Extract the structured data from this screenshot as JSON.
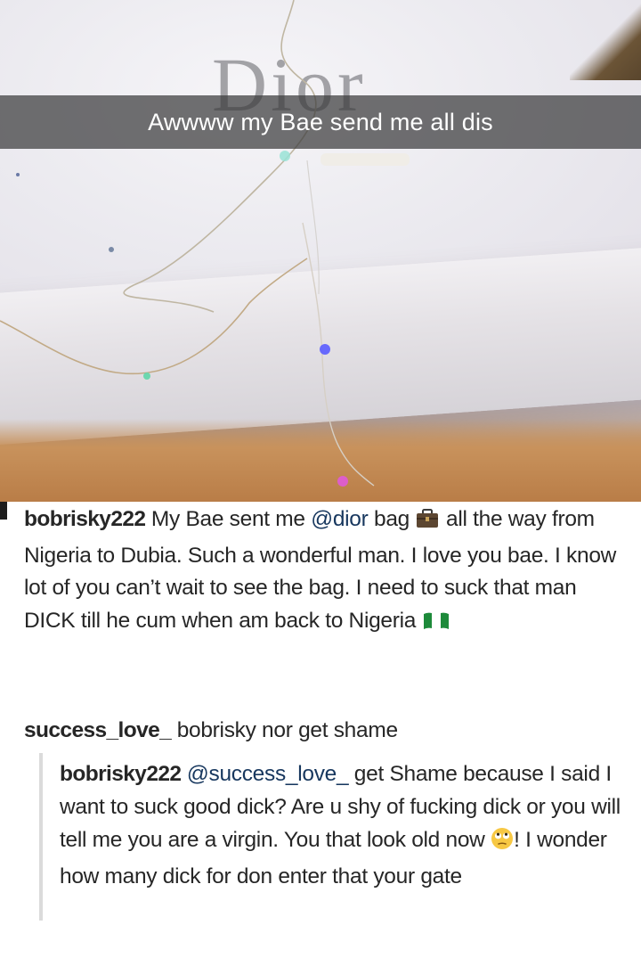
{
  "photo": {
    "logo_text": "Dior",
    "caption": "Awwww my Bae send me all dis"
  },
  "post": {
    "username": "bobrisky222",
    "text_part1": " My Bae sent me ",
    "mention": "@dior",
    "text_part2": " bag ",
    "icon_bag": "briefcase-emoji",
    "text_part3": " all the way from Nigeria to Dubia. Such a wonderful man. I love you bae. I know lot of you can’t wait to see the bag. I need to suck that man DICK till he cum when am back to Nigeria ",
    "icon_flag": "nigeria-flag-emoji"
  },
  "comment": {
    "username": "success_love_",
    "text": " bobrisky nor get shame"
  },
  "reply": {
    "username": "bobrisky222",
    "mention": "@success_love_",
    "text_part1": " get Shame because I said I want to suck good dick? Are u shy of fucking dick or you will tell me you are a virgin. You that look old now ",
    "icon_face": "face-with-rolling-eyes-emoji",
    "text_part2": "! I wonder how many dick for don enter that your gate"
  },
  "colors": {
    "text": "#262626",
    "mention": "#17375e",
    "caption_bg": "#3a3a3c",
    "reply_line": "#dbdbdb"
  }
}
